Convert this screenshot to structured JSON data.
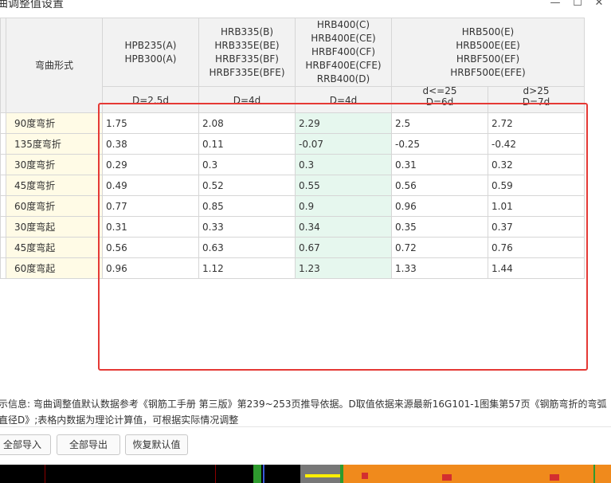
{
  "window": {
    "title": "曲调整值设置",
    "min_glyph": "—",
    "max_glyph": "☐",
    "close_glyph": "✕"
  },
  "table": {
    "corner_label": "弯曲形式",
    "groups": [
      {
        "label": "HPB235(A)\nHPB300(A)"
      },
      {
        "label": "HRB335(B)\nHRB335E(BE)\nHRBF335(BF)\nHRBF335E(BFE)"
      },
      {
        "label": "HRB400(C)\nHRB400E(CE)\nHRBF400(CF)\nHRBF400E(CFE)\nRRB400(D)"
      },
      {
        "label": "HRB500(E)\nHRB500E(EE)\nHRBF500(EF)\nHRBF500E(EFE)"
      }
    ],
    "subheaders": [
      "D=2.5d",
      "D=4d",
      "D=4d",
      "d<=25\nD=6d",
      "d>25\nD=7d"
    ],
    "rows": [
      {
        "label": "90度弯折",
        "values": [
          "1.75",
          "2.08",
          "2.29",
          "2.5",
          "2.72"
        ]
      },
      {
        "label": "135度弯折",
        "values": [
          "0.38",
          "0.11",
          "-0.07",
          "-0.25",
          "-0.42"
        ]
      },
      {
        "label": "30度弯折",
        "values": [
          "0.29",
          "0.3",
          "0.3",
          "0.31",
          "0.32"
        ]
      },
      {
        "label": "45度弯折",
        "values": [
          "0.49",
          "0.52",
          "0.55",
          "0.56",
          "0.59"
        ]
      },
      {
        "label": "60度弯折",
        "values": [
          "0.77",
          "0.85",
          "0.9",
          "0.96",
          "1.01"
        ]
      },
      {
        "label": "30度弯起",
        "values": [
          "0.31",
          "0.33",
          "0.34",
          "0.35",
          "0.37"
        ]
      },
      {
        "label": "45度弯起",
        "values": [
          "0.56",
          "0.63",
          "0.67",
          "0.72",
          "0.76"
        ]
      },
      {
        "label": "60度弯起",
        "values": [
          "0.96",
          "1.12",
          "1.23",
          "1.33",
          "1.44"
        ]
      }
    ]
  },
  "info": {
    "line1": "示信息: 弯曲调整值默认数据参考《钢筋工手册 第三版》第239~253页推导依据。D取值依据来源最新16G101-1图集第57页《钢筋弯折的弯弧",
    "line2": "直径D》;表格内数据为理论计算值，可根据实际情况调整"
  },
  "buttons": {
    "import": "全部导入",
    "export": "全部导出",
    "reset": "恢复默认值"
  },
  "colors": {
    "highlight_border": "#e53935",
    "row_label_bg": "#fffbe6",
    "highlight_col_bg": "#e6f7ee",
    "header_bg": "#f2f2f2"
  }
}
